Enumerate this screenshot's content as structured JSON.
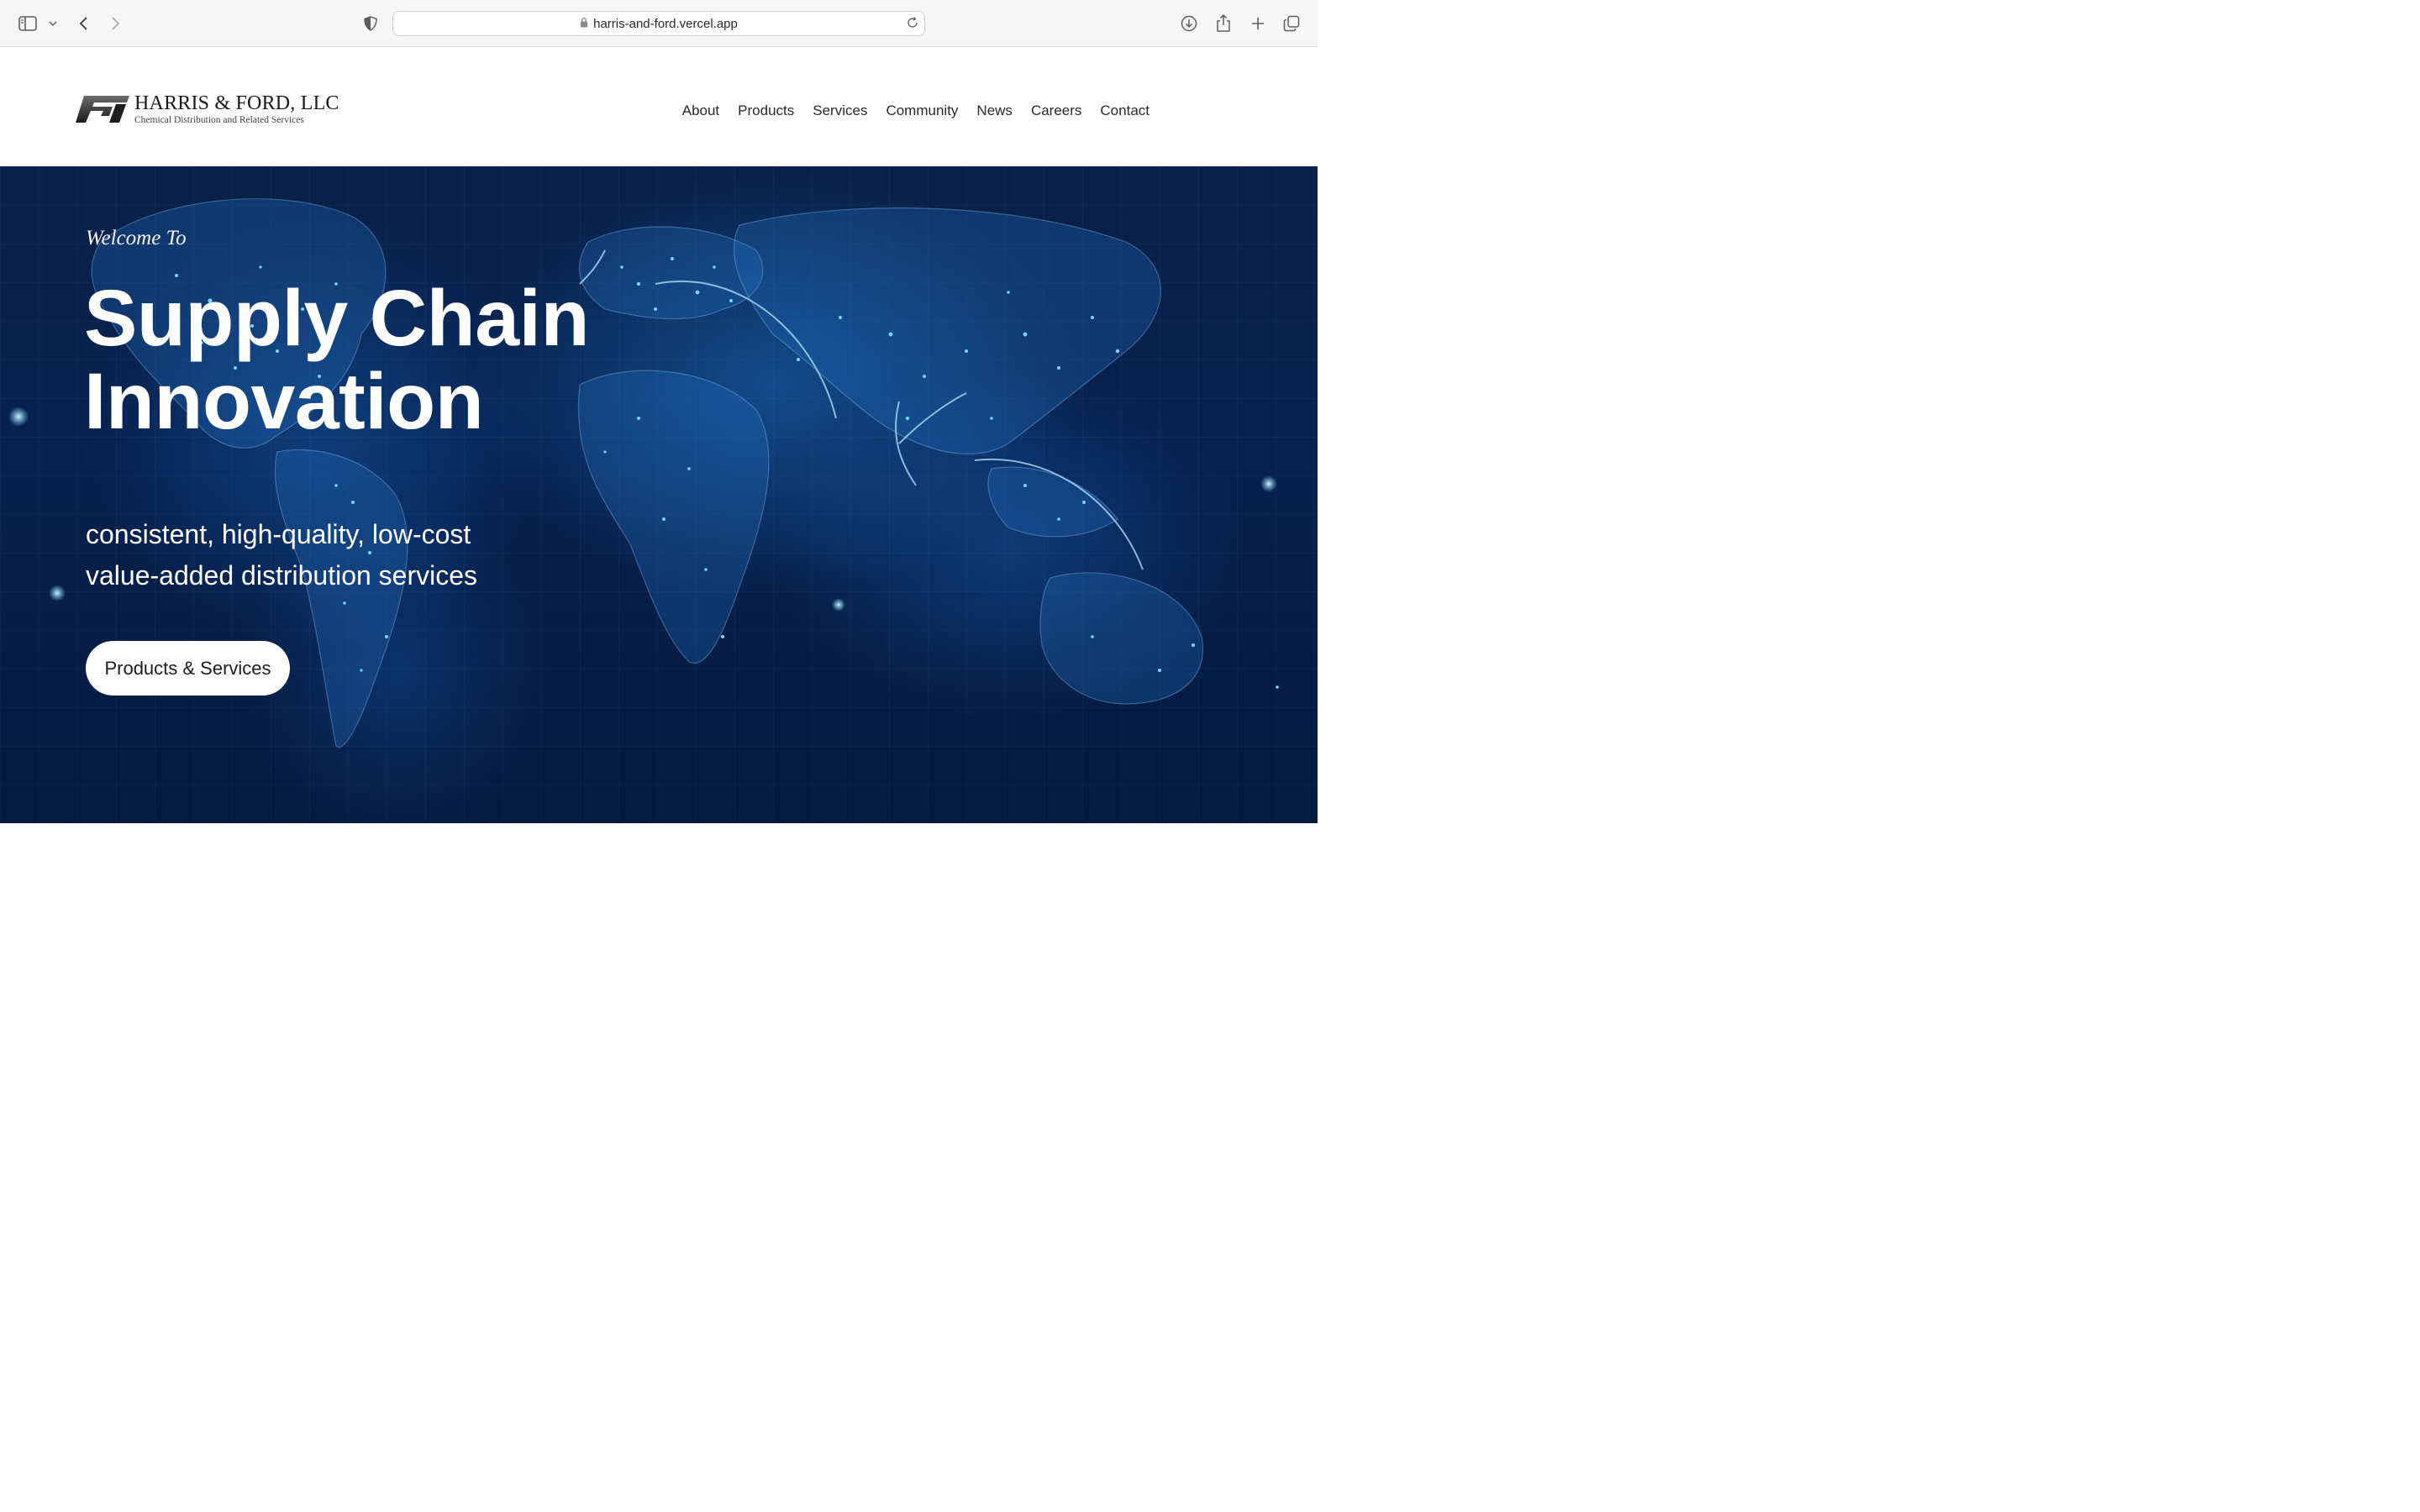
{
  "browser": {
    "url": "harris-and-ford.vercel.app",
    "icons": [
      "sidebar-icon",
      "chevron-down-icon",
      "back-icon",
      "forward-icon",
      "shield-icon",
      "lock-icon",
      "reload-icon",
      "download-icon",
      "share-icon",
      "plus-icon",
      "tabs-icon"
    ]
  },
  "header": {
    "logo_name": "HARRIS & FORD, LLC",
    "logo_tagline": "Chemical Distribution and Related Services",
    "nav": [
      {
        "label": "About"
      },
      {
        "label": "Products"
      },
      {
        "label": "Services"
      },
      {
        "label": "Community"
      },
      {
        "label": "News"
      },
      {
        "label": "Careers"
      },
      {
        "label": "Contact"
      }
    ]
  },
  "hero": {
    "welcome": "Welcome To",
    "headline_line1": "Supply Chain",
    "headline_line2": "Innovation",
    "sub_line1": "consistent, high-quality, low-cost",
    "sub_line2": "value-added distribution services",
    "cta_label": "Products & Services"
  },
  "colors": {
    "hero_background": "#06214f",
    "city_lights": "#7fd4ff",
    "accent_text": "#ffffff"
  }
}
